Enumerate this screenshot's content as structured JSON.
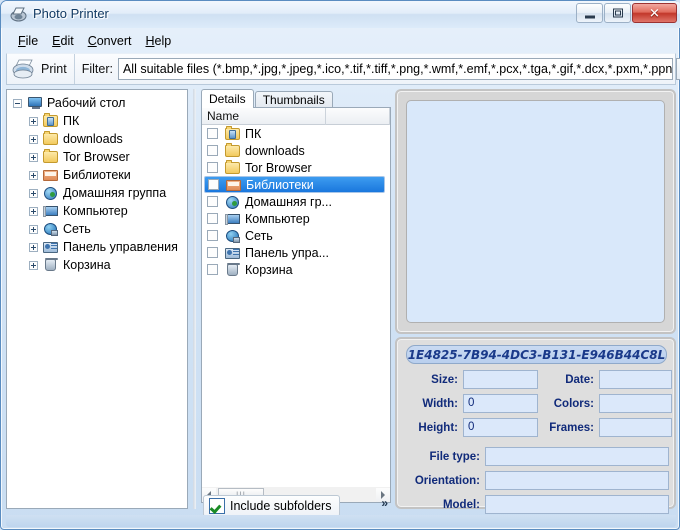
{
  "window": {
    "title": "Photo Printer",
    "icon": "app-printer-icon",
    "minimize": "–",
    "maximize": "□",
    "close": "✕"
  },
  "menubar": {
    "items": [
      {
        "label": "File",
        "accel": "F"
      },
      {
        "label": "Edit",
        "accel": "E"
      },
      {
        "label": "Convert",
        "accel": "C"
      },
      {
        "label": "Help",
        "accel": "H"
      }
    ]
  },
  "toolbar": {
    "print_label": "Print",
    "filter_label": "Filter:",
    "filter_value": "All suitable files (*.bmp,*.jpg,*.jpeg,*.ico,*.tif,*.tiff,*.png,*.wmf,*.emf,*.pcx,*.tga,*.gif,*.dcx,*.pxm,*.ppn",
    "combo_arrow": "▼"
  },
  "tree": {
    "root": {
      "label": "Рабочий стол",
      "icon": "desktop-icon",
      "expander": "minus"
    },
    "nodes": [
      {
        "label": "ПК",
        "icon": "user-folder-icon",
        "expander": "plus"
      },
      {
        "label": "downloads",
        "icon": "folder-icon",
        "expander": "plus"
      },
      {
        "label": "Tor Browser",
        "icon": "folder-icon",
        "expander": "plus"
      },
      {
        "label": "Библиотеки",
        "icon": "libraries-icon",
        "expander": "plus"
      },
      {
        "label": "Домашняя группа",
        "icon": "homegroup-icon",
        "expander": "plus"
      },
      {
        "label": "Компьютер",
        "icon": "computer-icon",
        "expander": "plus"
      },
      {
        "label": "Сеть",
        "icon": "network-icon",
        "expander": "plus"
      },
      {
        "label": "Панель управления",
        "icon": "control-panel-icon",
        "expander": "plus"
      },
      {
        "label": "Корзина",
        "icon": "recycle-bin-icon",
        "expander": "plus"
      }
    ]
  },
  "list": {
    "tabs": [
      {
        "label": "Details",
        "active": true
      },
      {
        "label": "Thumbnails",
        "active": false
      }
    ],
    "columns": [
      "Name",
      ""
    ],
    "rows": [
      {
        "label": "ПК",
        "icon": "user-folder-icon",
        "checked": false,
        "selected": false
      },
      {
        "label": "downloads",
        "icon": "folder-icon",
        "checked": false,
        "selected": false
      },
      {
        "label": "Tor Browser",
        "icon": "folder-icon",
        "checked": false,
        "selected": false
      },
      {
        "label": "Библиотеки",
        "icon": "libraries-icon",
        "checked": false,
        "selected": true
      },
      {
        "label": "Домашняя гр...",
        "icon": "homegroup-icon",
        "checked": false,
        "selected": false
      },
      {
        "label": "Компьютер",
        "icon": "computer-icon",
        "checked": false,
        "selected": false
      },
      {
        "label": "Сеть",
        "icon": "network-icon",
        "checked": false,
        "selected": false
      },
      {
        "label": "Панель упра...",
        "icon": "control-panel-icon",
        "checked": false,
        "selected": false
      },
      {
        "label": "Корзина",
        "icon": "recycle-bin-icon",
        "checked": false,
        "selected": false
      }
    ],
    "scroll_left": "◄",
    "scroll_right": "►",
    "include_subfolders_label": "Include subfolders",
    "expand_label": "»"
  },
  "details": {
    "id": "1E4825-7B94-4DC3-B131-E946B44C8L",
    "fields": [
      {
        "label": "Size:",
        "value": ""
      },
      {
        "label": "Date:",
        "value": ""
      },
      {
        "label": "Width:",
        "value": "0"
      },
      {
        "label": "Colors:",
        "value": ""
      },
      {
        "label": "Height:",
        "value": "0"
      },
      {
        "label": "Frames:",
        "value": ""
      },
      {
        "label": "File type:",
        "value": ""
      },
      {
        "label": "Orientation:",
        "value": ""
      },
      {
        "label": "Model:",
        "value": ""
      }
    ]
  },
  "colors": {
    "accent": "#1a77dd",
    "label_text": "#102a7a",
    "field_bg": "#dbe8fa",
    "preview_bg": "#d9e8fa",
    "close_button": "#c2372a"
  }
}
